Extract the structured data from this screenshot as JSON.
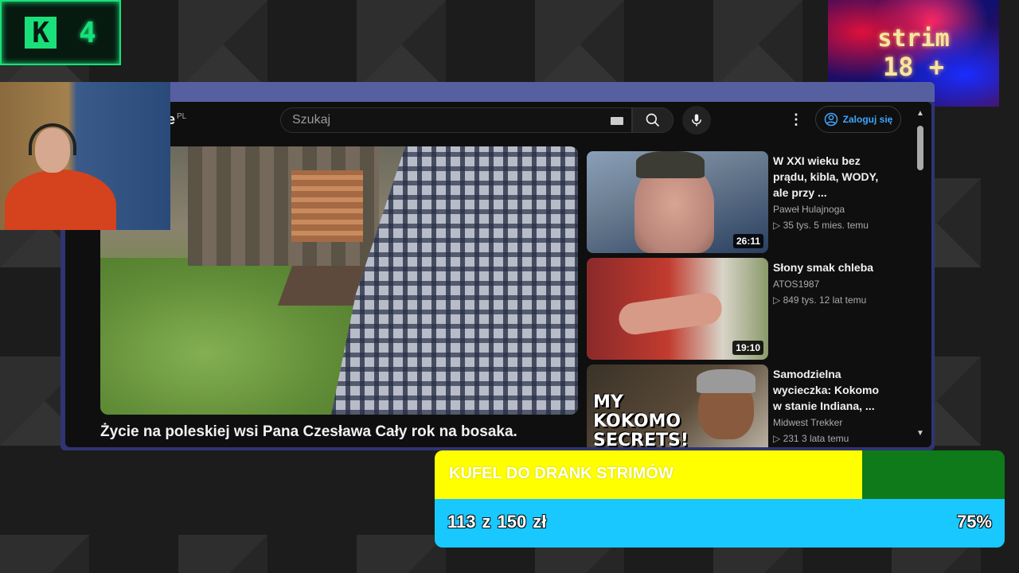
{
  "overlay": {
    "logo_letter": "K",
    "logo_number": "4",
    "strim_badge_line1": "strim",
    "strim_badge_line2": "18 +"
  },
  "youtube": {
    "logo_fragment": "e",
    "region_code": "PL",
    "search_placeholder": "Szukaj",
    "signin_label": "Zaloguj się",
    "more_label": "⋮",
    "video_title": "Życie na poleskiej wsi Pana Czesława Cały rok na bosaka.",
    "recommendations": [
      {
        "title": "W XXI wieku bez prądu, kibla, WODY, ale przy ...",
        "channel": "Paweł Hulajnoga",
        "views": "35 tys.",
        "age": "5 mies. temu",
        "duration": "26:11"
      },
      {
        "title": "Słony smak chleba",
        "channel": "ATOS1987",
        "views": "849 tys.",
        "age": "12 lat temu",
        "duration": "19:10"
      },
      {
        "title": "Samodzielna wycieczka: Kokomo w stanie Indiana, ...",
        "channel": "Midwest Trekker",
        "views": "231",
        "age": "3 lata temu",
        "thumbnail_text": "MY KOKOMO SECRETS!"
      }
    ]
  },
  "donation_goal": {
    "title": "KUFEL DO DRANK STRIMÓW",
    "current": "113",
    "separator": "z",
    "target": "150",
    "currency": "zł",
    "percent_label": "75%",
    "progress": 0.75,
    "colors": {
      "fill_top": "#ffff00",
      "rest_top": "#0e7a1a",
      "bottom": "#18c8ff"
    }
  }
}
